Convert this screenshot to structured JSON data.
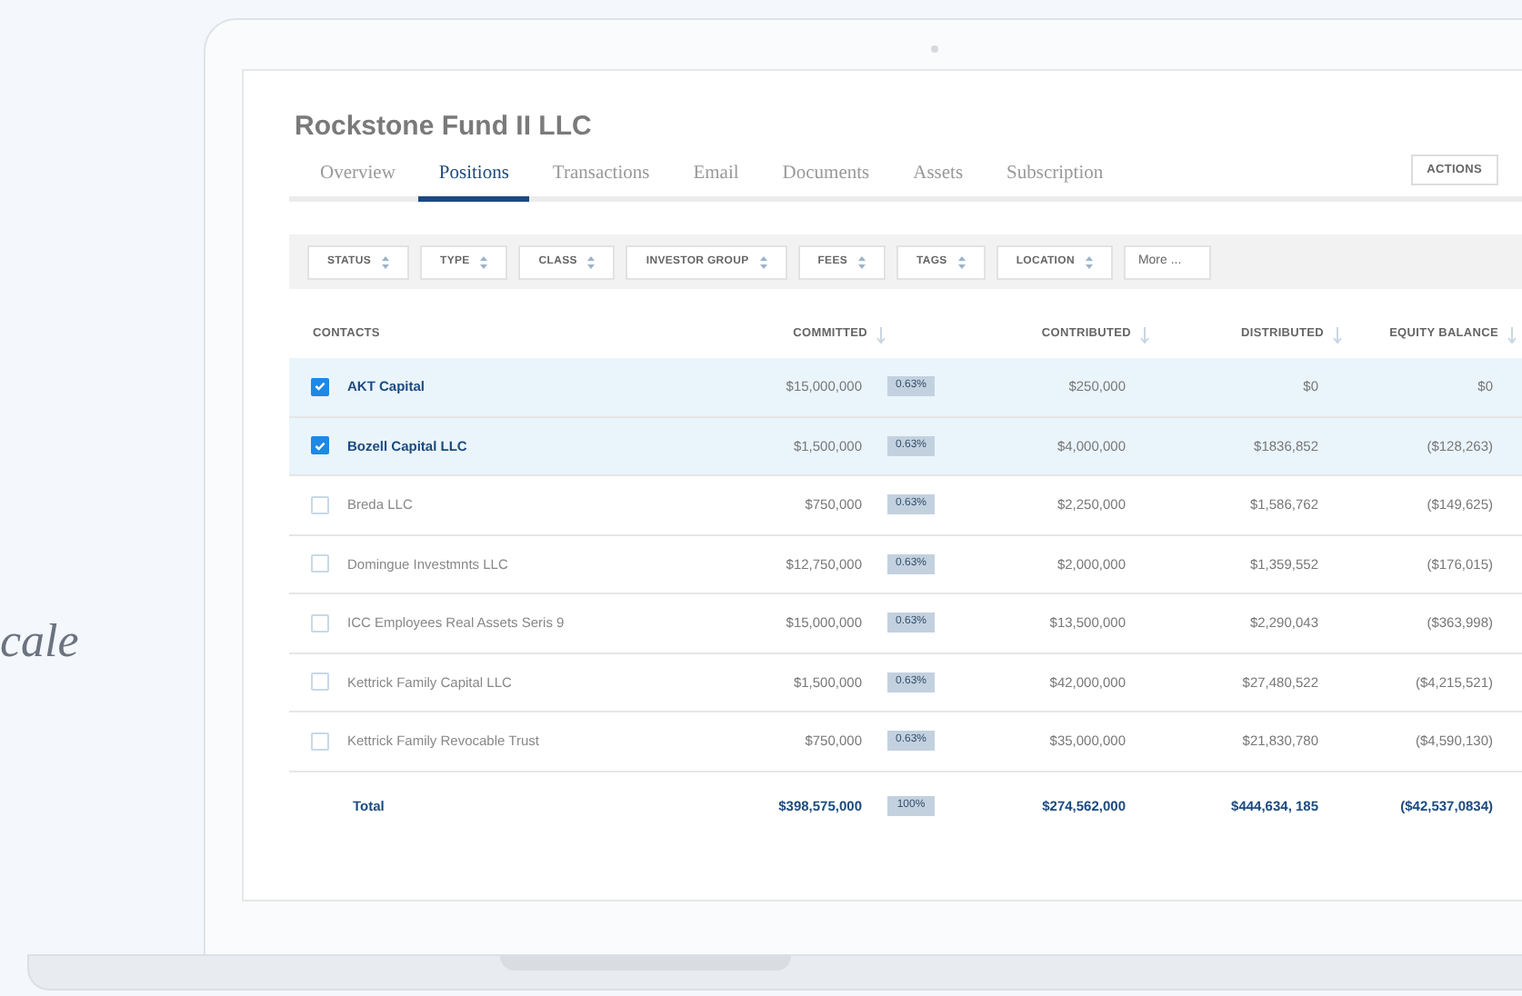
{
  "side_text": "cale",
  "fund": {
    "title": "Rockstone Fund II LLC"
  },
  "tabs": [
    {
      "label": "Overview",
      "selected": false
    },
    {
      "label": "Positions",
      "selected": true
    },
    {
      "label": "Transactions",
      "selected": false
    },
    {
      "label": "Email",
      "selected": false
    },
    {
      "label": "Documents",
      "selected": false
    },
    {
      "label": "Assets",
      "selected": false
    },
    {
      "label": "Subscription",
      "selected": false
    }
  ],
  "actions_button": "ACTIONS",
  "filters": [
    {
      "label": "STATUS",
      "kind": "select"
    },
    {
      "label": "TYPE",
      "kind": "select"
    },
    {
      "label": "CLASS",
      "kind": "select"
    },
    {
      "label": "INVESTOR GROUP",
      "kind": "select"
    },
    {
      "label": "FEES",
      "kind": "select"
    },
    {
      "label": "TAGS",
      "kind": "select"
    },
    {
      "label": "LOCATION",
      "kind": "select"
    },
    {
      "label": "More ...",
      "kind": "more"
    }
  ],
  "table": {
    "columns": [
      {
        "label": "CONTACTS",
        "sortable": false
      },
      {
        "label": "COMMITTED",
        "sortable": true
      },
      {
        "label": "CONTRIBUTED",
        "sortable": true
      },
      {
        "label": "DISTRIBUTED",
        "sortable": true
      },
      {
        "label": "EQUITY BALANCE",
        "sortable": true
      }
    ],
    "rows": [
      {
        "contact": "AKT Capital",
        "selected": true,
        "committed": "$15,000,000",
        "share": "0.63%",
        "contributed": "$250,000",
        "distributed": "$0",
        "equity_balance": "$0"
      },
      {
        "contact": "Bozell Capital LLC",
        "selected": true,
        "committed": "$1,500,000",
        "share": "0.63%",
        "contributed": "$4,000,000",
        "distributed": "$1836,852",
        "equity_balance": "($128,263)"
      },
      {
        "contact": "Breda LLC",
        "selected": false,
        "committed": "$750,000",
        "share": "0.63%",
        "contributed": "$2,250,000",
        "distributed": "$1,586,762",
        "equity_balance": "($149,625)"
      },
      {
        "contact": "Domingue Investmnts LLC",
        "selected": false,
        "committed": "$12,750,000",
        "share": "0.63%",
        "contributed": "$2,000,000",
        "distributed": "$1,359,552",
        "equity_balance": "($176,015)"
      },
      {
        "contact": "ICC Employees Real Assets Seris 9",
        "selected": false,
        "committed": "$15,000,000",
        "share": "0.63%",
        "contributed": "$13,500,000",
        "distributed": "$2,290,043",
        "equity_balance": "($363,998)"
      },
      {
        "contact": "Kettrick Family Capital LLC",
        "selected": false,
        "committed": "$1,500,000",
        "share": "0.63%",
        "contributed": "$42,000,000",
        "distributed": "$27,480,522",
        "equity_balance": "($4,215,521)"
      },
      {
        "contact": "Kettrick Family Revocable Trust",
        "selected": false,
        "committed": "$750,000",
        "share": "0.63%",
        "contributed": "$35,000,000",
        "distributed": "$21,830,780",
        "equity_balance": "($4,590,130)"
      }
    ],
    "total": {
      "label": "Total",
      "committed": "$398,575,000",
      "share": "100%",
      "contributed": "$274,562,000",
      "distributed": "$444,634, 185",
      "equity_balance": "($42,537,0834)"
    }
  }
}
